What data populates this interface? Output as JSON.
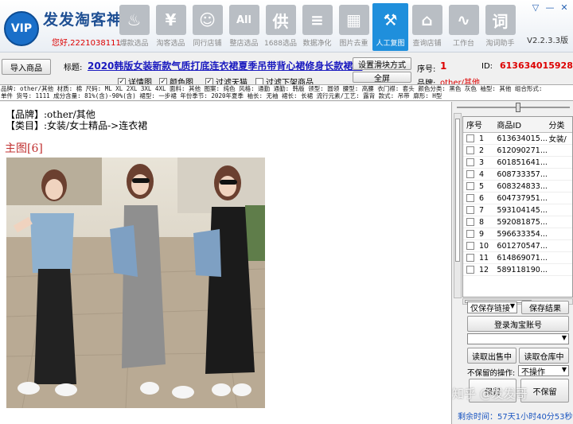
{
  "app": {
    "logo_text": "VIP",
    "title": "发发淘客神器",
    "greeting": "您好,2221038111",
    "version": "V2.2.3.3版"
  },
  "toolbar": {
    "items": [
      {
        "label": "爆款选品",
        "icon": "fire-icon",
        "glyph": "♨"
      },
      {
        "label": "淘客选品",
        "icon": "yen-icon",
        "glyph": "¥"
      },
      {
        "label": "同行店铺",
        "icon": "person-icon",
        "glyph": "☺"
      },
      {
        "label": "整店选品",
        "icon": "all-icon",
        "glyph": "All"
      },
      {
        "label": "1688选品",
        "icon": "supply-icon",
        "glyph": "供"
      },
      {
        "label": "数据净化",
        "icon": "filter-icon",
        "glyph": "≡"
      },
      {
        "label": "图片去重",
        "icon": "image-icon",
        "glyph": "▦"
      },
      {
        "label": "人工复图",
        "icon": "broom-icon",
        "glyph": "⚒"
      },
      {
        "label": "查询店铺",
        "icon": "house-icon",
        "glyph": "⌂"
      },
      {
        "label": "工作台",
        "icon": "chart-icon",
        "glyph": "∿"
      },
      {
        "label": "淘词助手",
        "icon": "word-icon",
        "glyph": "词"
      }
    ],
    "active_index": 7
  },
  "window_controls": [
    "▽",
    "—",
    "✕"
  ],
  "actions": {
    "import_label": "导入商品",
    "set_slider_label": "设置滑块方式",
    "fullscreen_label": "全屏"
  },
  "product": {
    "title_label": "标题:",
    "title": "2020韩版女装新款气质打底连衣裙夏季吊带背心裙修身长款裙子",
    "seq_label": "序号:",
    "seq": "1",
    "id_label": "ID:",
    "id": "613634015928",
    "brand_label": "品牌:",
    "brand": "other/其他"
  },
  "checkboxes": [
    {
      "label": "详情图",
      "checked": true
    },
    {
      "label": "颜色图",
      "checked": true
    },
    {
      "label": "过滤天猫",
      "checked": true
    },
    {
      "label": "过滤下架商品",
      "checked": false
    }
  ],
  "attributes_line1": "品牌: other/其他 材质: 棉 尺码: ML XL 2XL 3XL 4XL 面料: 其他 图案: 纯色 风格: 通勤 通勤: 韩版 领型: 圆领 腰型: 高腰 衣门襟: 套头 颜色分类: 黑色 灰色 袖型: 其他 组合形式:",
  "attributes_line2": "单件 货号: 1111 成分含量: 81%(含)-90%(含) 裙型: 一步裙 年份季节: 2020年夏季 袖长: 无袖 裙长: 长裙 流行元素/工艺: 露背 款式: 吊带 廓形: H型",
  "detail": {
    "brand_line": "【品牌】:other/其他",
    "category_line": "【类目】:女装/女士精品->连衣裙",
    "main_image_label": "主图[6]"
  },
  "grid": {
    "columns": [
      "序号",
      "商品ID",
      "分类"
    ],
    "rows": [
      {
        "no": "1",
        "id": "613634015...",
        "cat": "女装/"
      },
      {
        "no": "2",
        "id": "612090271...",
        "cat": ""
      },
      {
        "no": "3",
        "id": "601851641...",
        "cat": ""
      },
      {
        "no": "4",
        "id": "608733357...",
        "cat": ""
      },
      {
        "no": "5",
        "id": "608324833...",
        "cat": ""
      },
      {
        "no": "6",
        "id": "604737951...",
        "cat": ""
      },
      {
        "no": "7",
        "id": "593104145...",
        "cat": ""
      },
      {
        "no": "8",
        "id": "592081875...",
        "cat": ""
      },
      {
        "no": "9",
        "id": "596633354...",
        "cat": ""
      },
      {
        "no": "10",
        "id": "601270547...",
        "cat": ""
      },
      {
        "no": "11",
        "id": "614869071...",
        "cat": ""
      },
      {
        "no": "12",
        "id": "589118190...",
        "cat": ""
      }
    ]
  },
  "controls": {
    "save_mode": "仅保存链接",
    "save_result_label": "保存结果",
    "login_label": "登录淘宝账号",
    "read_sale_label": "读取出售中",
    "read_warehouse_label": "读取仓库中",
    "unsaved_op_label": "不保留的操作:",
    "unsaved_op_value": "不操作",
    "keep_label": "保留",
    "discard_label": "不保留"
  },
  "watermark": "知乎 @发发哥",
  "timer": "剩余时间：57天1小时40分53秒"
}
